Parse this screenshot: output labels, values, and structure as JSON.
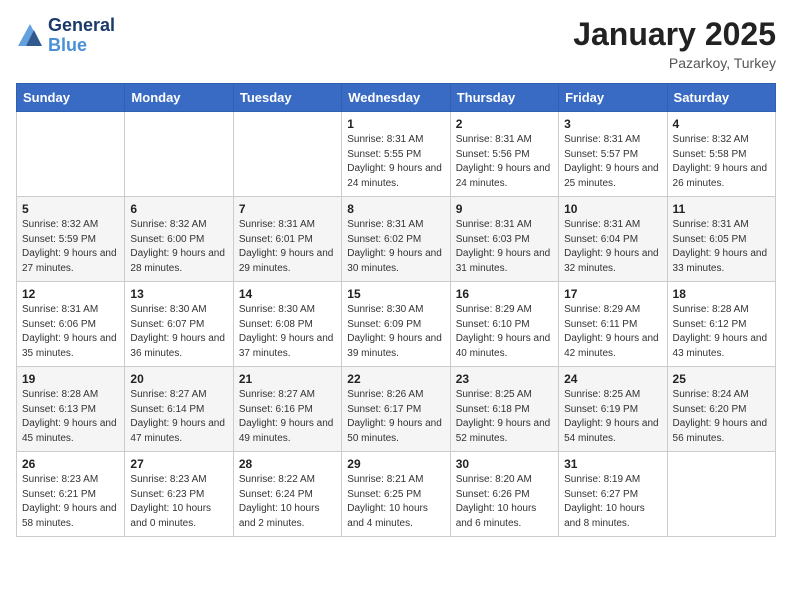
{
  "header": {
    "logo_line1": "General",
    "logo_line2": "Blue",
    "month": "January 2025",
    "location": "Pazarkoy, Turkey"
  },
  "weekdays": [
    "Sunday",
    "Monday",
    "Tuesday",
    "Wednesday",
    "Thursday",
    "Friday",
    "Saturday"
  ],
  "weeks": [
    [
      {
        "day": "",
        "info": ""
      },
      {
        "day": "",
        "info": ""
      },
      {
        "day": "",
        "info": ""
      },
      {
        "day": "1",
        "info": "Sunrise: 8:31 AM\nSunset: 5:55 PM\nDaylight: 9 hours and 24 minutes."
      },
      {
        "day": "2",
        "info": "Sunrise: 8:31 AM\nSunset: 5:56 PM\nDaylight: 9 hours and 24 minutes."
      },
      {
        "day": "3",
        "info": "Sunrise: 8:31 AM\nSunset: 5:57 PM\nDaylight: 9 hours and 25 minutes."
      },
      {
        "day": "4",
        "info": "Sunrise: 8:32 AM\nSunset: 5:58 PM\nDaylight: 9 hours and 26 minutes."
      }
    ],
    [
      {
        "day": "5",
        "info": "Sunrise: 8:32 AM\nSunset: 5:59 PM\nDaylight: 9 hours and 27 minutes."
      },
      {
        "day": "6",
        "info": "Sunrise: 8:32 AM\nSunset: 6:00 PM\nDaylight: 9 hours and 28 minutes."
      },
      {
        "day": "7",
        "info": "Sunrise: 8:31 AM\nSunset: 6:01 PM\nDaylight: 9 hours and 29 minutes."
      },
      {
        "day": "8",
        "info": "Sunrise: 8:31 AM\nSunset: 6:02 PM\nDaylight: 9 hours and 30 minutes."
      },
      {
        "day": "9",
        "info": "Sunrise: 8:31 AM\nSunset: 6:03 PM\nDaylight: 9 hours and 31 minutes."
      },
      {
        "day": "10",
        "info": "Sunrise: 8:31 AM\nSunset: 6:04 PM\nDaylight: 9 hours and 32 minutes."
      },
      {
        "day": "11",
        "info": "Sunrise: 8:31 AM\nSunset: 6:05 PM\nDaylight: 9 hours and 33 minutes."
      }
    ],
    [
      {
        "day": "12",
        "info": "Sunrise: 8:31 AM\nSunset: 6:06 PM\nDaylight: 9 hours and 35 minutes."
      },
      {
        "day": "13",
        "info": "Sunrise: 8:30 AM\nSunset: 6:07 PM\nDaylight: 9 hours and 36 minutes."
      },
      {
        "day": "14",
        "info": "Sunrise: 8:30 AM\nSunset: 6:08 PM\nDaylight: 9 hours and 37 minutes."
      },
      {
        "day": "15",
        "info": "Sunrise: 8:30 AM\nSunset: 6:09 PM\nDaylight: 9 hours and 39 minutes."
      },
      {
        "day": "16",
        "info": "Sunrise: 8:29 AM\nSunset: 6:10 PM\nDaylight: 9 hours and 40 minutes."
      },
      {
        "day": "17",
        "info": "Sunrise: 8:29 AM\nSunset: 6:11 PM\nDaylight: 9 hours and 42 minutes."
      },
      {
        "day": "18",
        "info": "Sunrise: 8:28 AM\nSunset: 6:12 PM\nDaylight: 9 hours and 43 minutes."
      }
    ],
    [
      {
        "day": "19",
        "info": "Sunrise: 8:28 AM\nSunset: 6:13 PM\nDaylight: 9 hours and 45 minutes."
      },
      {
        "day": "20",
        "info": "Sunrise: 8:27 AM\nSunset: 6:14 PM\nDaylight: 9 hours and 47 minutes."
      },
      {
        "day": "21",
        "info": "Sunrise: 8:27 AM\nSunset: 6:16 PM\nDaylight: 9 hours and 49 minutes."
      },
      {
        "day": "22",
        "info": "Sunrise: 8:26 AM\nSunset: 6:17 PM\nDaylight: 9 hours and 50 minutes."
      },
      {
        "day": "23",
        "info": "Sunrise: 8:25 AM\nSunset: 6:18 PM\nDaylight: 9 hours and 52 minutes."
      },
      {
        "day": "24",
        "info": "Sunrise: 8:25 AM\nSunset: 6:19 PM\nDaylight: 9 hours and 54 minutes."
      },
      {
        "day": "25",
        "info": "Sunrise: 8:24 AM\nSunset: 6:20 PM\nDaylight: 9 hours and 56 minutes."
      }
    ],
    [
      {
        "day": "26",
        "info": "Sunrise: 8:23 AM\nSunset: 6:21 PM\nDaylight: 9 hours and 58 minutes."
      },
      {
        "day": "27",
        "info": "Sunrise: 8:23 AM\nSunset: 6:23 PM\nDaylight: 10 hours and 0 minutes."
      },
      {
        "day": "28",
        "info": "Sunrise: 8:22 AM\nSunset: 6:24 PM\nDaylight: 10 hours and 2 minutes."
      },
      {
        "day": "29",
        "info": "Sunrise: 8:21 AM\nSunset: 6:25 PM\nDaylight: 10 hours and 4 minutes."
      },
      {
        "day": "30",
        "info": "Sunrise: 8:20 AM\nSunset: 6:26 PM\nDaylight: 10 hours and 6 minutes."
      },
      {
        "day": "31",
        "info": "Sunrise: 8:19 AM\nSunset: 6:27 PM\nDaylight: 10 hours and 8 minutes."
      },
      {
        "day": "",
        "info": ""
      }
    ]
  ]
}
